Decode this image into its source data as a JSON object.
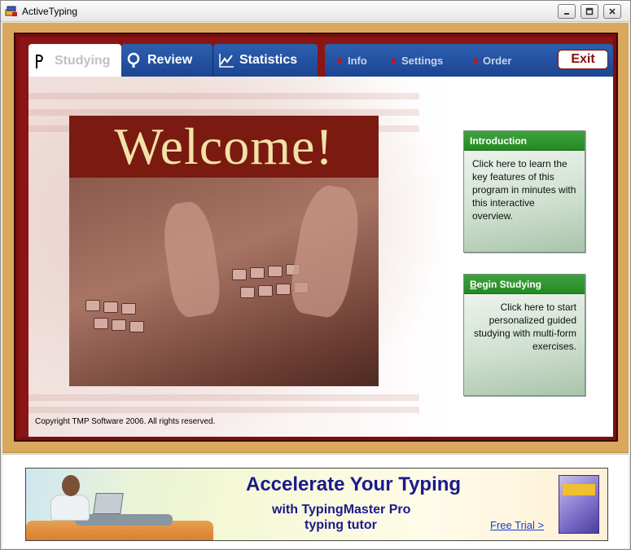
{
  "window": {
    "title": "ActiveTyping"
  },
  "tabs": [
    {
      "label": "Studying",
      "active": true
    },
    {
      "label": "Review",
      "active": false
    },
    {
      "label": "Statistics",
      "active": false
    }
  ],
  "menu": {
    "info": "Info",
    "settings": "Settings",
    "order": "Order",
    "exit": "Exit"
  },
  "welcome": {
    "heading": "Welcome!"
  },
  "cards": {
    "introduction": {
      "title": "Introduction",
      "body": "Click here to learn the key features of this program in minutes with this interactive overview."
    },
    "begin": {
      "title_underline": "B",
      "title_rest": "egin Studying",
      "body": "Click here to start personalized guided studying with multi-form exercises."
    }
  },
  "copyright": "Copyright TMP Software 2006. All rights reserved.",
  "ad": {
    "headline": "Accelerate Your Typing",
    "line1_prefix": "with ",
    "line1_product": "TypingMaster Pro",
    "line2": "typing tutor",
    "link": "Free Trial >"
  },
  "colors": {
    "frame_red": "#7a0f10",
    "tab_blue": "#1c4592",
    "card_green": "#238a23",
    "tan": "#d9a85c",
    "welcome_text": "#f3e2a8"
  },
  "icons": [
    "app-icon",
    "flag-icon",
    "magnifier-icon",
    "chart-icon",
    "minimize-icon",
    "maximize-icon",
    "close-icon"
  ]
}
